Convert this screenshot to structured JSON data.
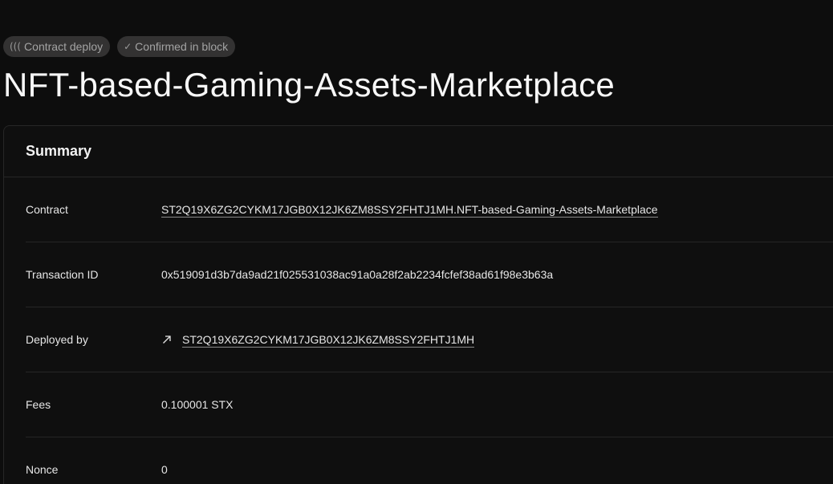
{
  "badges": {
    "contract_deploy": {
      "icon": "(((",
      "label": "Contract deploy"
    },
    "confirmed": {
      "icon": "✓",
      "label": "Confirmed in block"
    }
  },
  "page_title": "NFT-based-Gaming-Assets-Marketplace",
  "summary": {
    "title": "Summary",
    "rows": [
      {
        "label": "Contract",
        "value": "ST2Q19X6ZG2CYKM17JGB0X12JK6ZM8SSY2FHTJ1MH.NFT-based-Gaming-Assets-Marketplace"
      },
      {
        "label": "Transaction ID",
        "value": "0x519091d3b7da9ad21f025531038ac91a0a28f2ab2234fcfef38ad61f98e3b63a"
      },
      {
        "label": "Deployed by",
        "value": "ST2Q19X6ZG2CYKM17JGB0X12JK6ZM8SSY2FHTJ1MH",
        "icon": "arrow-up-right-icon"
      },
      {
        "label": "Fees",
        "value": "0.100001 STX"
      },
      {
        "label": "Nonce",
        "value": "0"
      }
    ]
  },
  "colors": {
    "background": "#0d0d0d",
    "badge_bg": "#333232",
    "border": "#262626"
  }
}
